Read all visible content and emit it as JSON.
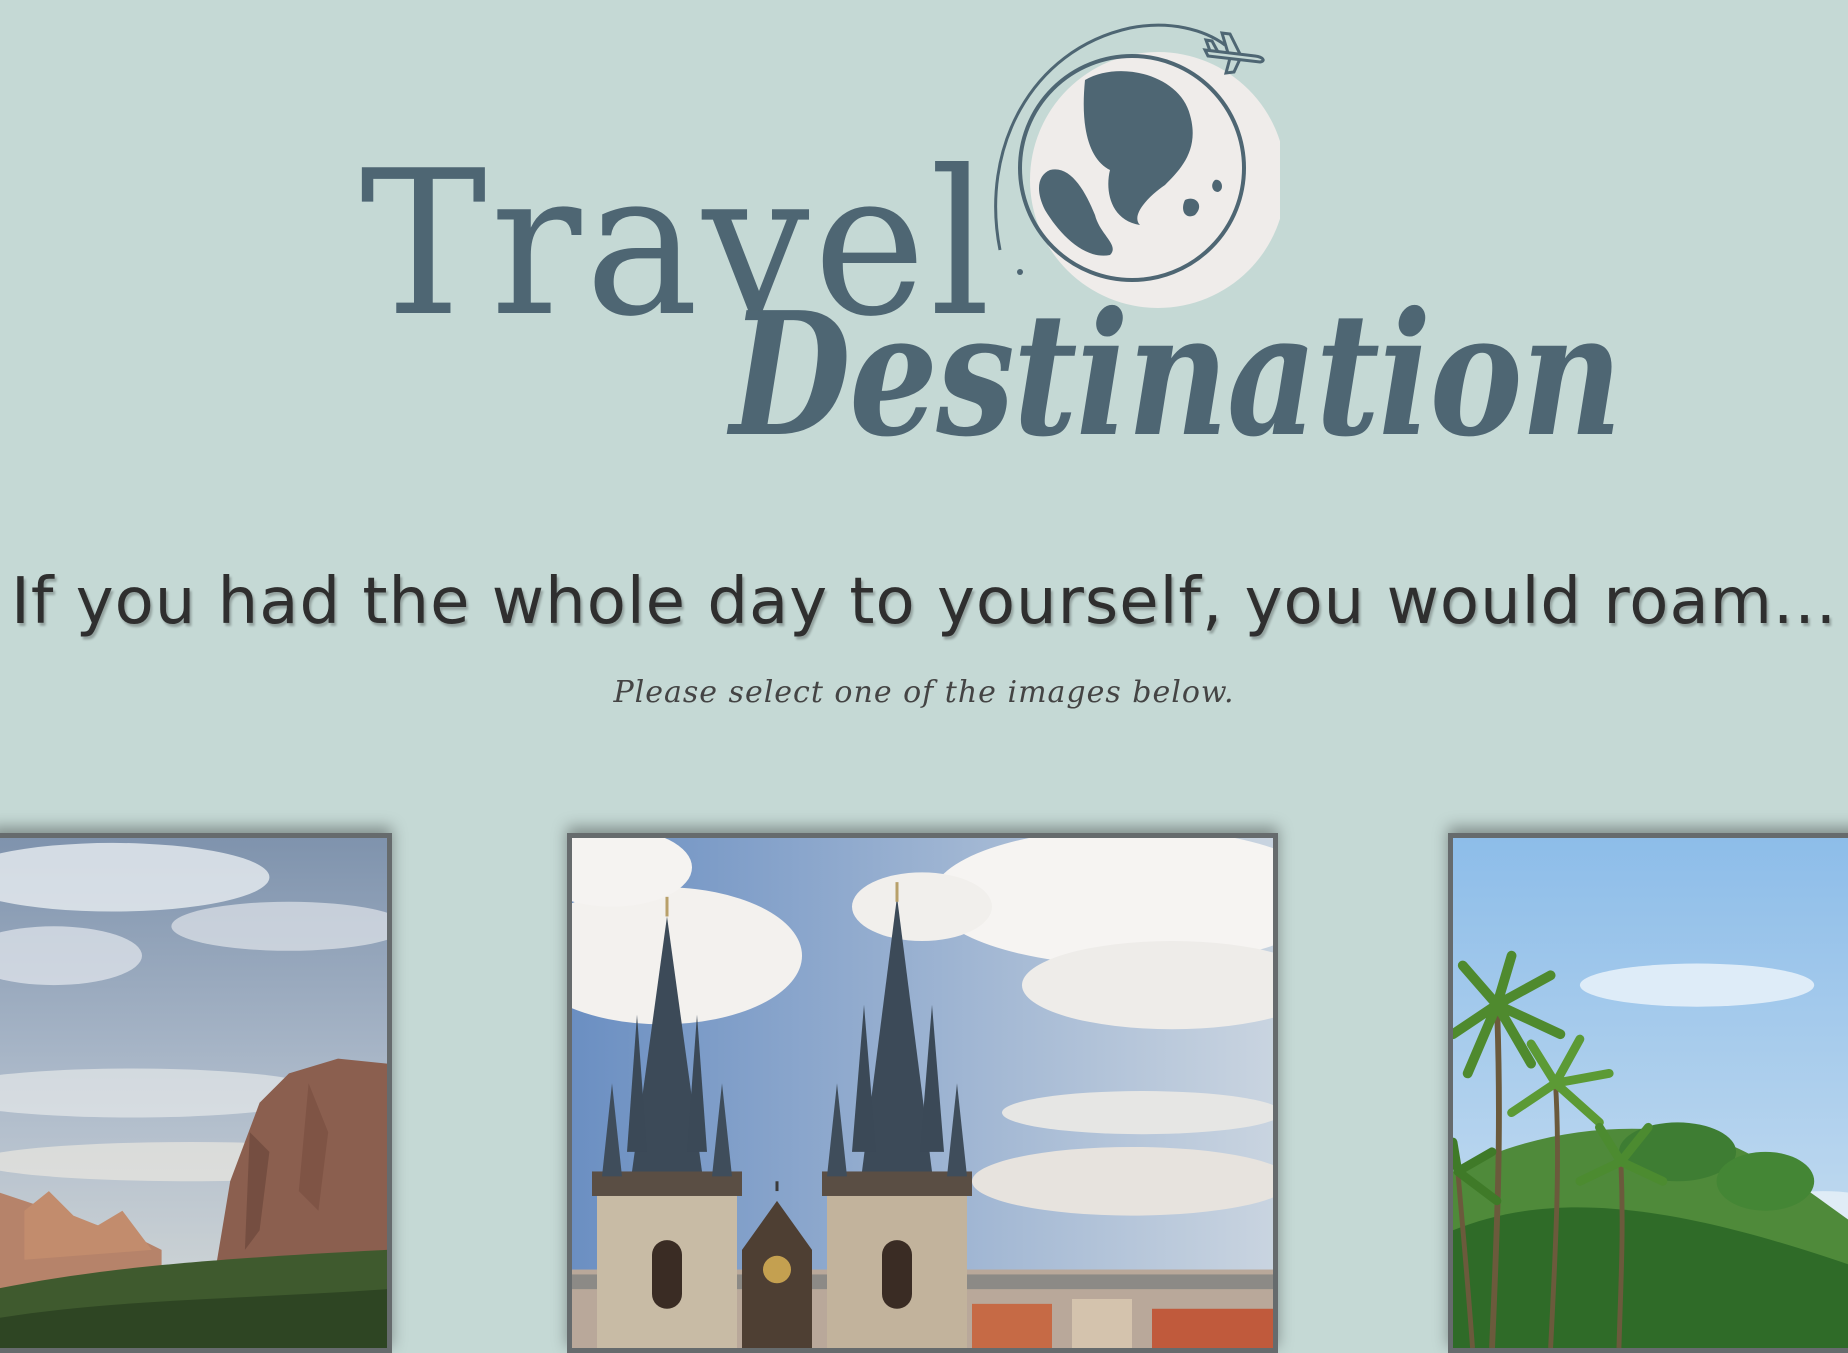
{
  "logo": {
    "word1": "Travel",
    "word2": "Destination",
    "icons": [
      "globe-icon",
      "airplane-icon"
    ]
  },
  "prompt": {
    "headline": "If you had the whole day to yourself, you would roam...",
    "instruction": "Please select one of the images below."
  },
  "options": [
    {
      "name": "canyon-photo",
      "subject": "red rock canyon cliffs under cloudy sky"
    },
    {
      "name": "gothic-church-photo",
      "subject": "twin gothic spires over old town rooftops"
    },
    {
      "name": "tropical-palms-photo",
      "subject": "palm trees under blue sky"
    }
  ],
  "colors": {
    "background": "#c5d9d5",
    "logo": "#4e6673",
    "card_border": "#666b6d",
    "text": "#2f2f2f"
  }
}
